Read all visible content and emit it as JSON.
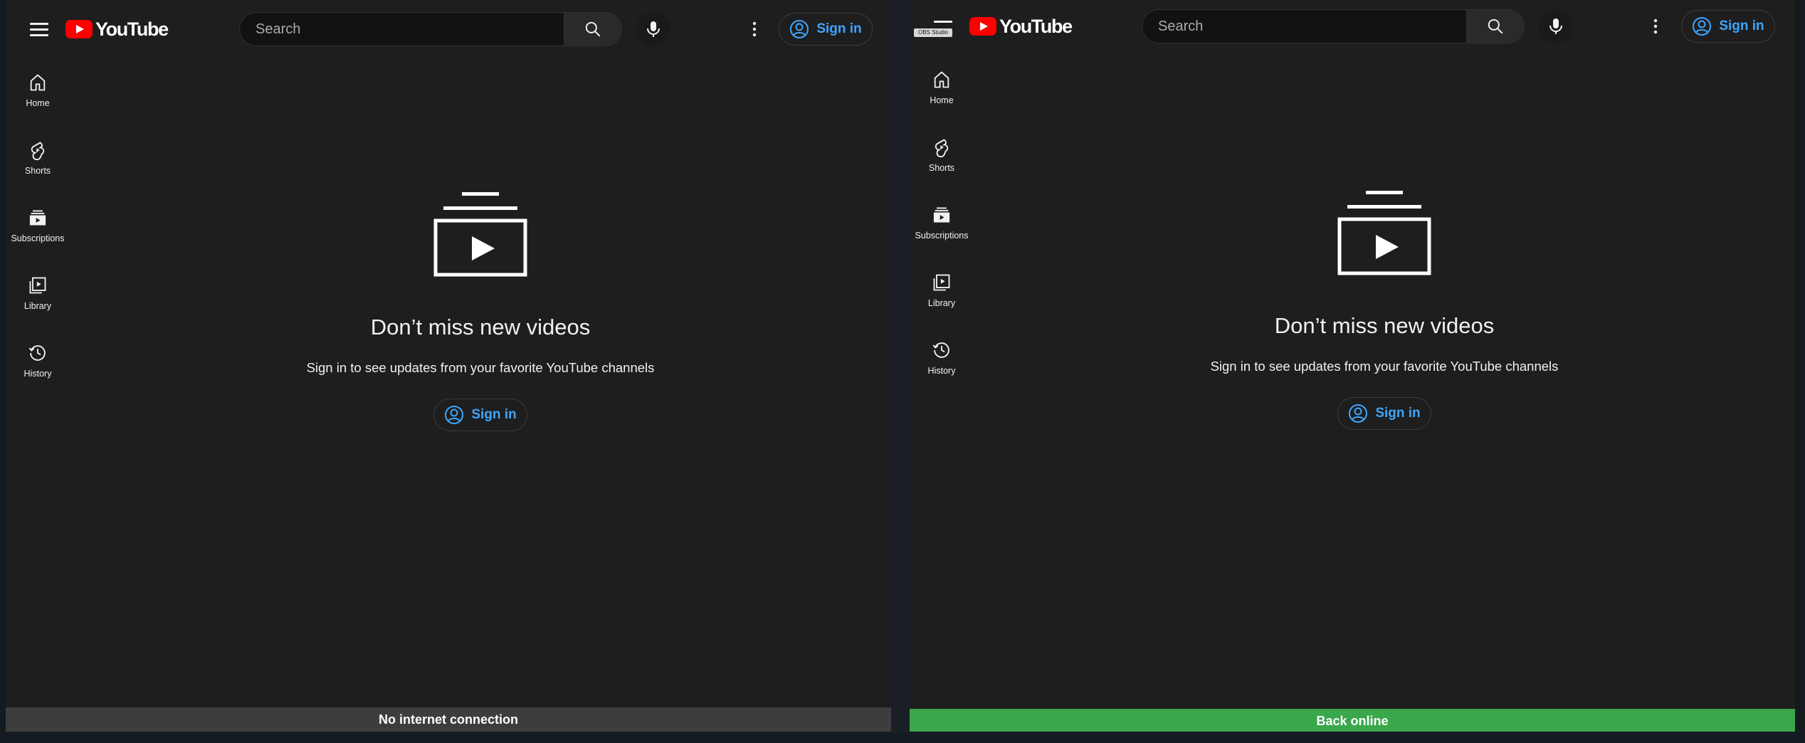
{
  "colors": {
    "accent_blue": "#3ea6ff",
    "youtube_red": "#ff0000",
    "offline_bar": "#3d3d3d",
    "online_bar": "#3aa74b",
    "page_bg": "#1e1e1e"
  },
  "panels": [
    {
      "logo_text": "YouTube",
      "search_placeholder": "Search",
      "signin_label": "Sign in",
      "sidebar": [
        {
          "label": "Home",
          "icon": "home-icon"
        },
        {
          "label": "Shorts",
          "icon": "shorts-icon"
        },
        {
          "label": "Subscriptions",
          "icon": "subscriptions-icon"
        },
        {
          "label": "Library",
          "icon": "library-icon"
        },
        {
          "label": "History",
          "icon": "history-icon"
        }
      ],
      "headline": "Don’t miss new videos",
      "subline": "Sign in to see updates from your favorite YouTube channels",
      "cta_label": "Sign in",
      "status_text": "No internet connection"
    },
    {
      "obs_badge": "OBS Studio",
      "logo_text": "YouTube",
      "search_placeholder": "Search",
      "signin_label": "Sign in",
      "sidebar": [
        {
          "label": "Home",
          "icon": "home-icon"
        },
        {
          "label": "Shorts",
          "icon": "shorts-icon"
        },
        {
          "label": "Subscriptions",
          "icon": "subscriptions-icon"
        },
        {
          "label": "Library",
          "icon": "library-icon"
        },
        {
          "label": "History",
          "icon": "history-icon"
        }
      ],
      "headline": "Don’t miss new videos",
      "subline": "Sign in to see updates from your favorite YouTube channels",
      "cta_label": "Sign in",
      "status_text": "Back online"
    }
  ]
}
